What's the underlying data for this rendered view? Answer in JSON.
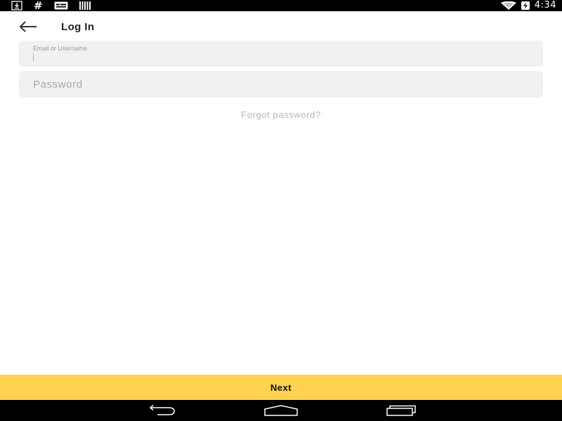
{
  "status_bar": {
    "time": "4:34",
    "left_icons": [
      "download-icon",
      "hash-icon",
      "message-icon",
      "barcode-icon"
    ],
    "right_icons": [
      "wifi-icon",
      "battery-charging-icon"
    ],
    "hash_glyph": "#"
  },
  "header": {
    "title": "Log In",
    "back_icon": "arrow-left-icon"
  },
  "form": {
    "email": {
      "label": "Email or Username",
      "value": ""
    },
    "password": {
      "placeholder": "Password",
      "value": ""
    },
    "forgot_password": "Forgot password?"
  },
  "footer": {
    "next_label": "Next"
  },
  "nav_bar": {
    "buttons": [
      "back-nav-icon",
      "home-nav-icon",
      "recents-nav-icon"
    ]
  },
  "colors": {
    "accent": "#ffd24f",
    "caret": "#f5b400",
    "field_bg": "#f1f1f1"
  }
}
